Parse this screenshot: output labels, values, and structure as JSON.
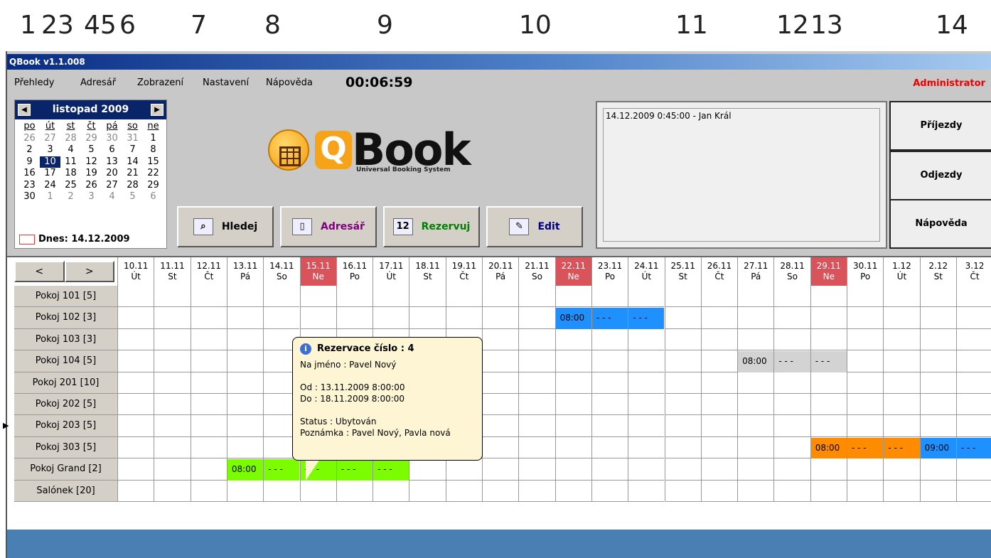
{
  "annotations": [
    "1",
    "23",
    "45",
    "6",
    "7",
    "8",
    "9",
    "10",
    "11",
    "12",
    "13",
    "14"
  ],
  "window_title": "QBook v1.1.008",
  "menu": [
    "Přehledy",
    "Adresář",
    "Zobrazení",
    "Nastavení",
    "Nápověda"
  ],
  "clock": "00:06:59",
  "user": "Administrator",
  "calendar": {
    "month": "listopad 2009",
    "prev_icon": "left-arrow-icon",
    "next_icon": "right-arrow-icon",
    "dow": [
      "po",
      "út",
      "st",
      "čt",
      "pá",
      "so",
      "ne"
    ],
    "weeks": [
      [
        "26",
        "27",
        "28",
        "29",
        "30",
        "31",
        "1"
      ],
      [
        "2",
        "3",
        "4",
        "5",
        "6",
        "7",
        "8"
      ],
      [
        "9",
        "10",
        "11",
        "12",
        "13",
        "14",
        "15"
      ],
      [
        "16",
        "17",
        "18",
        "19",
        "20",
        "21",
        "22"
      ],
      [
        "23",
        "24",
        "25",
        "26",
        "27",
        "28",
        "29"
      ],
      [
        "30",
        "1",
        "2",
        "3",
        "4",
        "5",
        "6"
      ]
    ],
    "selected": "10",
    "today": "Dnes: 14.12.2009"
  },
  "logo": {
    "q": "Q",
    "word": "Book",
    "subtitle": "Universal Booking System"
  },
  "buttons": {
    "search": "Hledej",
    "addressbook": "Adresář",
    "reserve": "Rezervuj",
    "edit": "Edit",
    "calendar_icon_text": "12"
  },
  "note_text": "14.12.2009 0:45:00 - Jan Král",
  "side_buttons": [
    "Příjezdy",
    "Odjezdy",
    "Nápověda"
  ],
  "nav": {
    "prev": "<",
    "next": ">"
  },
  "days": [
    {
      "date": "10.11",
      "dow": "Út"
    },
    {
      "date": "11.11",
      "dow": "St"
    },
    {
      "date": "12.11",
      "dow": "Čt"
    },
    {
      "date": "13.11",
      "dow": "Pá"
    },
    {
      "date": "14.11",
      "dow": "So"
    },
    {
      "date": "15.11",
      "dow": "Ne",
      "weekend": true
    },
    {
      "date": "16.11",
      "dow": "Po"
    },
    {
      "date": "17.11",
      "dow": "Út"
    },
    {
      "date": "18.11",
      "dow": "St"
    },
    {
      "date": "19.11",
      "dow": "Čt"
    },
    {
      "date": "20.11",
      "dow": "Pá"
    },
    {
      "date": "21.11",
      "dow": "So"
    },
    {
      "date": "22.11",
      "dow": "Ne",
      "weekend": true
    },
    {
      "date": "23.11",
      "dow": "Po"
    },
    {
      "date": "24.11",
      "dow": "Út"
    },
    {
      "date": "25.11",
      "dow": "St"
    },
    {
      "date": "26.11",
      "dow": "Čt"
    },
    {
      "date": "27.11",
      "dow": "Pá"
    },
    {
      "date": "28.11",
      "dow": "So"
    },
    {
      "date": "29.11",
      "dow": "Ne",
      "weekend": true
    },
    {
      "date": "30.11",
      "dow": "Po"
    },
    {
      "date": "1.12",
      "dow": "Út"
    },
    {
      "date": "2.12",
      "dow": "St"
    },
    {
      "date": "3.12",
      "dow": "Čt"
    }
  ],
  "rooms": [
    "Pokoj 101 [5]",
    "Pokoj 102 [3]",
    "Pokoj 103 [3]",
    "Pokoj 104 [5]",
    "Pokoj 201 [10]",
    "Pokoj 202 [5]",
    "Pokoj 203 [5]",
    "Pokoj 303 [5]",
    "Pokoj Grand [2]",
    "Salónek [20]"
  ],
  "current_row_marker": "▶",
  "reservations": [
    {
      "row": 1,
      "start": 12,
      "cells": [
        "08:00",
        "- - -",
        "- - -"
      ],
      "color": "#1e90ff"
    },
    {
      "row": 3,
      "start": 17,
      "cells": [
        "08:00",
        "- - -",
        "- - -"
      ],
      "color": "#d3d3d3"
    },
    {
      "row": 7,
      "start": 19,
      "cells": [
        "08:00",
        "- - -",
        "- - -"
      ],
      "color": "#ff8c00"
    },
    {
      "row": 7,
      "start": 22,
      "cells": [
        "09:00",
        "- - -"
      ],
      "color": "#1e90ff"
    },
    {
      "row": 8,
      "start": 3,
      "cells": [
        "08:00",
        "- - -",
        "- - -",
        "- - -",
        "- - -"
      ],
      "color": "#7cfc00"
    }
  ],
  "tooltip": {
    "title": "Rezervace číslo : 4",
    "name": "Na jméno : Pavel Nový",
    "from": "Od : 13.11.2009 8:00:00",
    "to": "Do : 18.11.2009 8:00:00",
    "status": "Status : Ubytován",
    "note": "Poznámka : Pavel Nový, Pavla nová"
  }
}
